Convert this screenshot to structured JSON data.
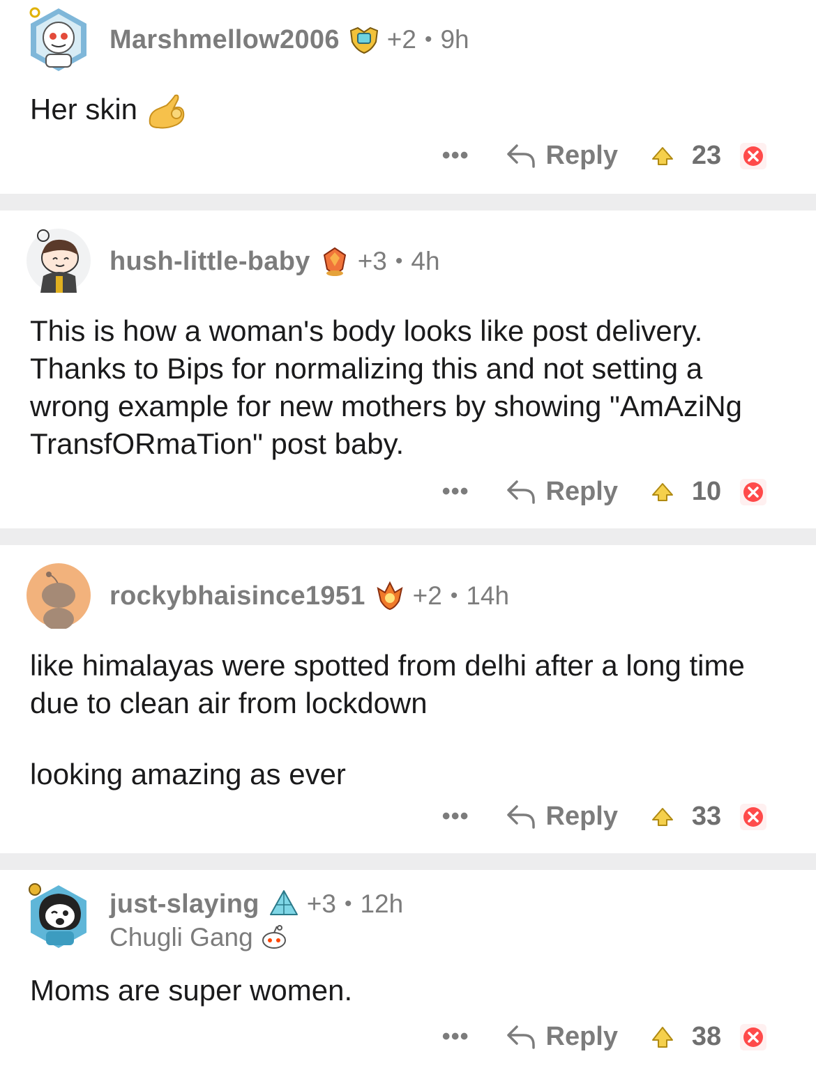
{
  "comments": [
    {
      "username": "Marshmellow2006",
      "award_count": "+2",
      "separator": "•",
      "age": "9h",
      "body": [
        "Her skin"
      ],
      "actions": {
        "more": "•••",
        "reply": "Reply",
        "score": "23"
      }
    },
    {
      "username": "hush-little-baby",
      "award_count": "+3",
      "separator": "•",
      "age": "4h",
      "body": [
        "This is how a woman's body looks like post delivery. Thanks to Bips for normalizing this and not setting a wrong example for new mothers by showing \"AmAziNg TransfORmaTion\" post baby."
      ],
      "actions": {
        "more": "•••",
        "reply": "Reply",
        "score": "10"
      }
    },
    {
      "username": "rockybhaisince1951",
      "award_count": "+2",
      "separator": "•",
      "age": "14h",
      "body": [
        "like himalayas were spotted from delhi after a long time due to clean air from lockdown",
        "looking amazing as ever"
      ],
      "actions": {
        "more": "•••",
        "reply": "Reply",
        "score": "33"
      }
    },
    {
      "username": "just-slaying",
      "award_count": "+3",
      "separator": "•",
      "age": "12h",
      "flair": "Chugli Gang",
      "body": [
        "Moms are super women."
      ],
      "actions": {
        "more": "•••",
        "reply": "Reply",
        "score": "38"
      }
    }
  ],
  "colors": {
    "meta_text": "#7c7c7c",
    "body_text": "#1a1a1b",
    "separator": "#ededee",
    "downvote": "#ff4a4a",
    "upvote_fill": "#f5d04c"
  },
  "icons": [
    "reply-arrow-icon",
    "upvote-icon",
    "downvote-icon",
    "trophy-icon",
    "ok-hand-emoji",
    "snoo-flair-icon"
  ]
}
